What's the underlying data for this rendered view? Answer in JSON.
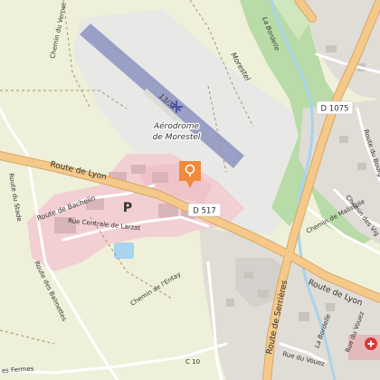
{
  "map": {
    "colors": {
      "background": "#eef0d9",
      "urban": "#e0dcd6",
      "urban_dark": "#d4d0cb",
      "commercial": "#f2cfd2",
      "airfield": "#e8e8e6",
      "runway": "#9aa0c6",
      "forest": "#b8dba7",
      "water": "#a9d3ee",
      "road_major": "#f4c98a",
      "road_major_casing": "#d9a766",
      "road_minor": "#ffffff",
      "route_label_box": "#ffffff",
      "marker": "#f08a3c",
      "parking": "#3a8fd6",
      "hospital": "#d93636"
    },
    "marker_icon": "map-pin-icon",
    "parking_icon": "parking-icon",
    "airport_icon": "airport-icon",
    "hospital_icon": "hospital-icon",
    "labels": {
      "aerodrome": [
        "Aérodrome",
        "de Morestel"
      ],
      "runway": "13/31",
      "morestel": "Morestel",
      "route_de_lyon_w": "Route de Lyon",
      "route_de_lyon_e": "Route de Lyon",
      "d517": "D 517",
      "d1075": "D 1075",
      "route_de_bachelin": "Route de Bachelin",
      "rue_centrale_de_larzat": "Rue Centrale de Larzat",
      "route_du_stade": "Route du Stade",
      "route_des_balmettes": "Route des Balmettes",
      "chemin_du_vernet": "Chemin du Vernet",
      "chemin_de_lentay": "Chemin de l'Entay",
      "route_de_serrieres": "Route de Serrières",
      "chemin_de_malissole": "Chemin de Malissole",
      "chemin_des_vignes": "Chemin des Vig",
      "route_du_bourg": "Route du Bourg",
      "la_bordelle_n": "La Bordelle",
      "la_bordelle_s": "La Bordelle",
      "rue_du_vouez": "Rue du Vouez",
      "rue_du_vouez_v": "Rue du Vouez",
      "c10": "C 10",
      "fermes": "es Fermes",
      "parking": "P"
    }
  }
}
